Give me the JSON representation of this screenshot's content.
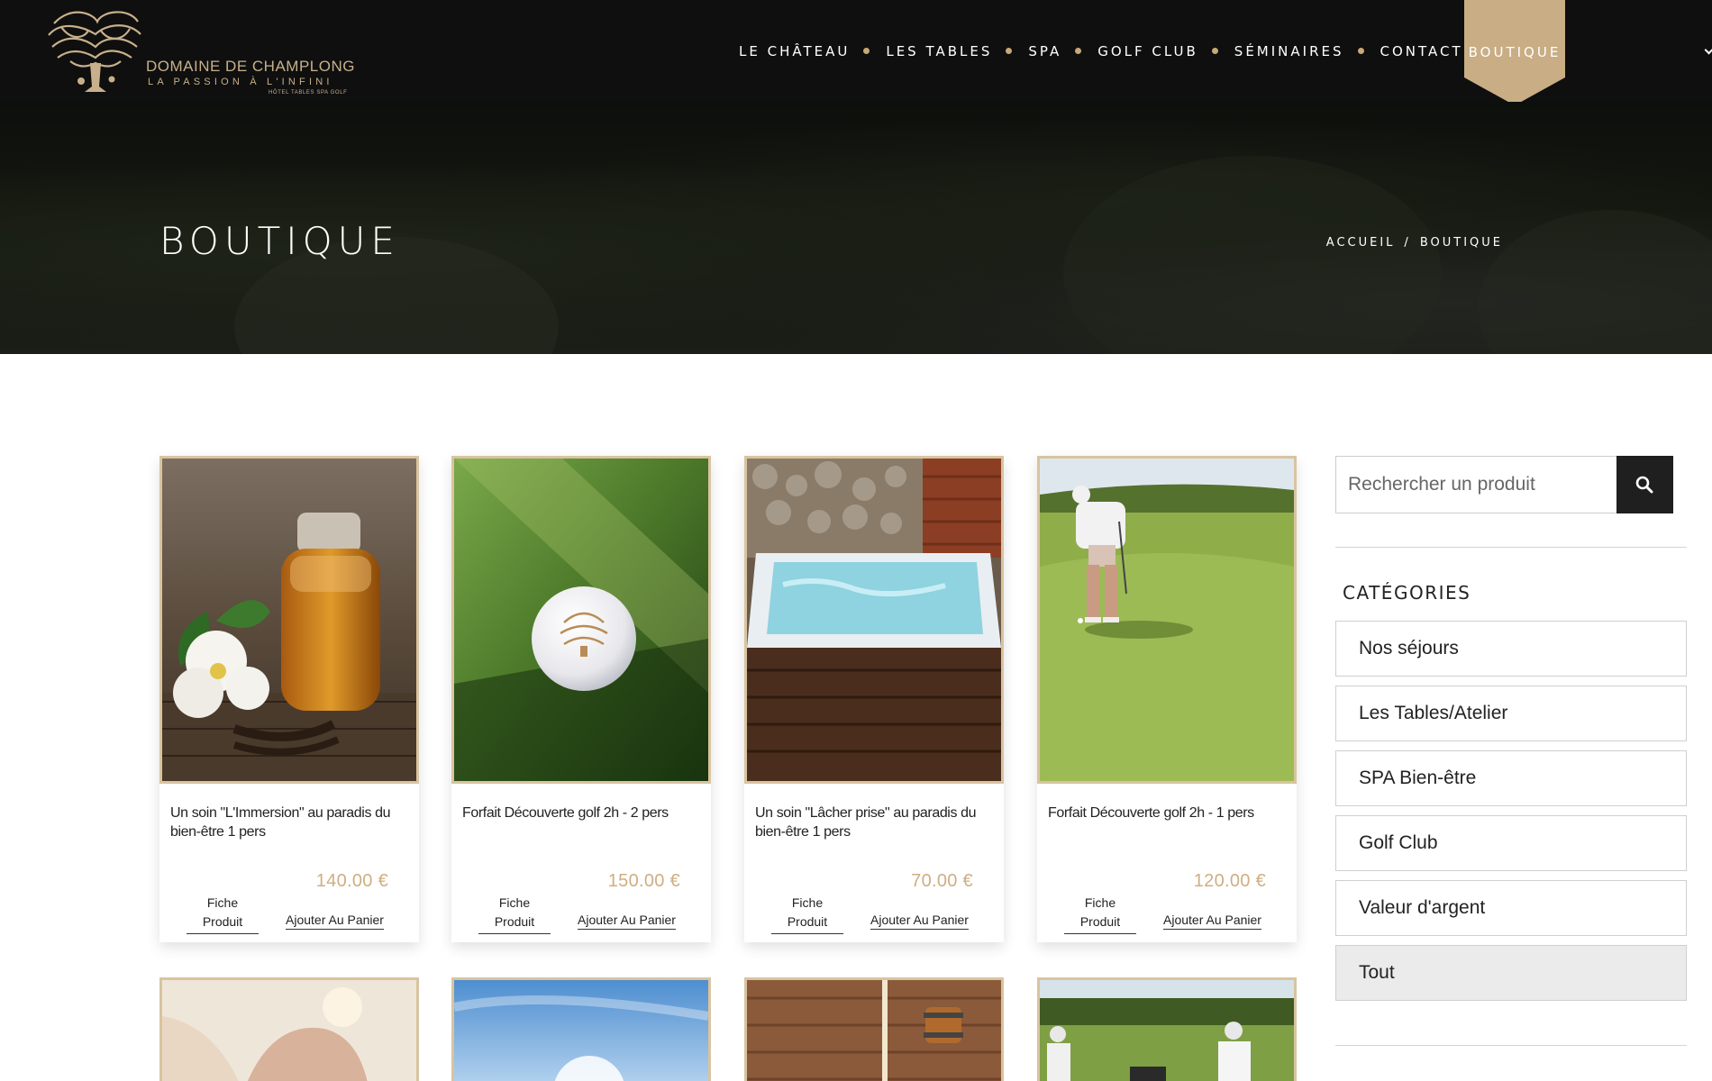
{
  "brand": {
    "name": "DOMAINE DE CHAMPLONG",
    "tagline": "LA PASSION À L'INFINI",
    "subline": "HÔTEL TABLES SPA GOLF",
    "accent": "#c8a977",
    "price_color": "#cfae82"
  },
  "nav": {
    "items": [
      "LE CHÂTEAU",
      "LES TABLES",
      "SPA",
      "GOLF CLUB",
      "SÉMINAIRES",
      "CONTACT"
    ],
    "active": "BOUTIQUE"
  },
  "hero": {
    "title": "BOUTIQUE",
    "breadcrumb_home": "ACCUEIL",
    "breadcrumb_sep": "/",
    "breadcrumb_current": "BOUTIQUE"
  },
  "products": [
    {
      "title": "Un soin \"L'Immersion\" au paradis du bien-être 1 pers",
      "price": "140.00 €",
      "link1": "Fiche Produit",
      "link2": "Ajouter Au Panier",
      "image": "oil-flower-photo"
    },
    {
      "title": "Forfait Découverte golf 2h - 2 pers",
      "price": "150.00 €",
      "link1": "Fiche Produit",
      "link2": "Ajouter Au Panier",
      "image": "golf-ball-photo"
    },
    {
      "title": "Un soin \"Lâcher prise\" au paradis du bien-être 1 pers",
      "price": "70.00 €",
      "link1": "Fiche Produit",
      "link2": "Ajouter Au Panier",
      "image": "jacuzzi-photo"
    },
    {
      "title": "Forfait Découverte golf 2h - 1 pers",
      "price": "120.00 €",
      "link1": "Fiche Produit",
      "link2": "Ajouter Au Panier",
      "image": "golfer-putting-photo"
    }
  ],
  "products_row2": [
    {
      "image": "massage-photo"
    },
    {
      "image": "sky-photo"
    },
    {
      "image": "sauna-photo"
    },
    {
      "image": "golfers-photo"
    }
  ],
  "sidebar": {
    "search_placeholder": "Rechercher un produit",
    "categories_title": "CATÉGORIES",
    "categories": [
      "Nos séjours",
      "Les Tables/Atelier",
      "SPA Bien-être",
      "Golf Club",
      "Valeur d'argent",
      "Tout"
    ],
    "active_category": "Tout"
  }
}
